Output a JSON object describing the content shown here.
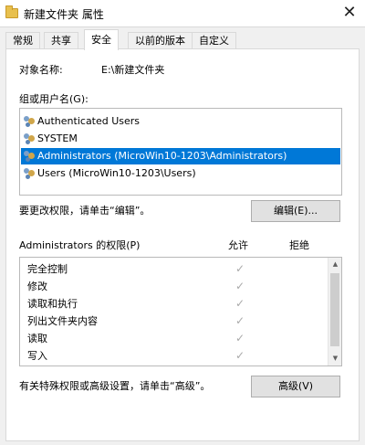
{
  "window": {
    "title": "新建文件夹 属性",
    "close": "✕"
  },
  "tabs": [
    {
      "label": "常规"
    },
    {
      "label": "共享"
    },
    {
      "label": "安全"
    },
    {
      "label": "以前的版本"
    },
    {
      "label": "自定义"
    }
  ],
  "object": {
    "label": "对象名称:",
    "value": "E:\\新建文件夹"
  },
  "groups": {
    "label": "组或用户名(G):",
    "items": [
      {
        "name": "Authenticated Users"
      },
      {
        "name": "SYSTEM"
      },
      {
        "name": "Administrators (MicroWin10-1203\\Administrators)"
      },
      {
        "name": "Users (MicroWin10-1203\\Users)"
      }
    ],
    "selected_index": 2
  },
  "edit": {
    "hint": "要更改权限，请单击“编辑”。",
    "button": "编辑(E)..."
  },
  "permissions": {
    "title": "Administrators 的权限(P)",
    "allow_header": "允许",
    "deny_header": "拒绝",
    "rows": [
      {
        "name": "完全控制",
        "mark": "✓"
      },
      {
        "name": "修改",
        "mark": "✓"
      },
      {
        "name": "读取和执行",
        "mark": "✓"
      },
      {
        "name": "列出文件夹内容",
        "mark": "✓"
      },
      {
        "name": "读取",
        "mark": "✓"
      },
      {
        "name": "写入",
        "mark": "✓"
      }
    ],
    "scroll_up": "▲",
    "scroll_down": "▼"
  },
  "advanced": {
    "hint": "有关特殊权限或高级设置，请单击“高级”。",
    "button": "高级(V)"
  },
  "colors": {
    "selection": "#0078d7",
    "check": "#a9a9a9"
  }
}
